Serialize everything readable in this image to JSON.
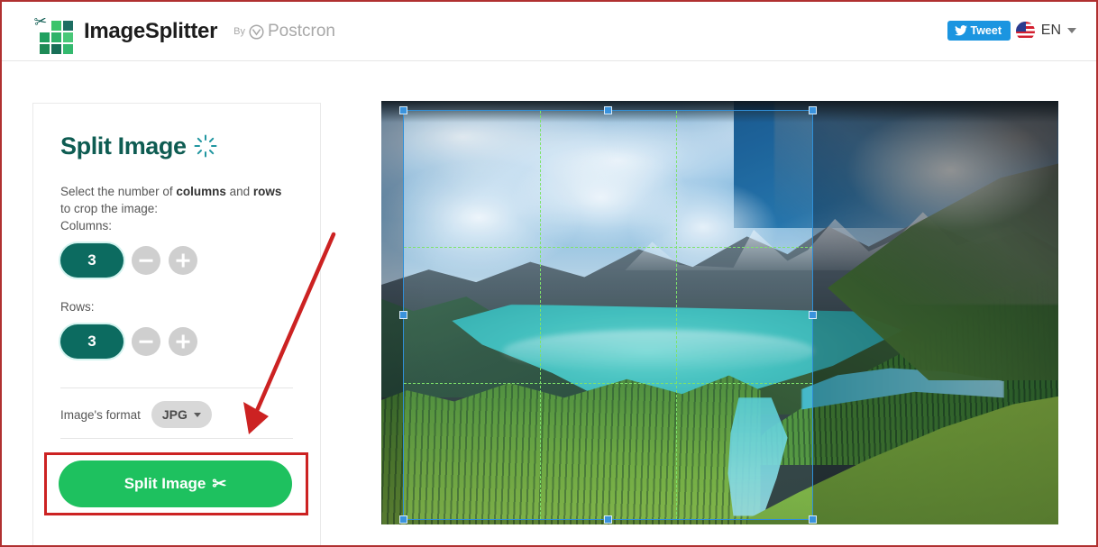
{
  "header": {
    "brand_name": "ImageSplitter",
    "by_word": "By",
    "partner_name": "Postcron",
    "tweet_label": "Tweet",
    "lang_label": "EN",
    "logo_icon": "scissors-grid-icon",
    "twitter_icon": "twitter-bird-icon",
    "flag_icon": "us-flag-icon",
    "caret_icon": "chevron-down-icon"
  },
  "panel": {
    "title": "Split Image",
    "title_icon": "sparkle-burst-icon",
    "description_prefix": "Select the number of ",
    "description_bold_1": "columns",
    "description_middle": " and ",
    "description_bold_2": "rows",
    "description_suffix": " to crop the image:",
    "columns_label": "Columns:",
    "columns_value": "3",
    "rows_label": "Rows:",
    "rows_value": "3",
    "minus_icon": "minus-icon",
    "plus_icon": "plus-icon",
    "format_label": "Image's format",
    "format_value": "JPG",
    "format_caret_icon": "chevron-down-icon",
    "split_button_label": "Split Image",
    "split_button_icon": "scissors-icon",
    "split_button_glyph": "✂"
  },
  "annotations": {
    "arrow": "red-arrow-pointing-to-split-button",
    "highlight": "red-rectangle-around-split-button",
    "arrow_color": "#cc2222",
    "highlight_color": "#cc2222"
  },
  "image_panel": {
    "name": "mountain-lake-landscape",
    "crop_columns": 3,
    "crop_rows": 3,
    "selection_border_color": "#2f8fd8",
    "grid_line_color": "#7ee36a"
  },
  "colors": {
    "teal": "#0c6b60",
    "green_button": "#1ec15f",
    "twitter_blue": "#1b95e0",
    "title_teal": "#0e5c52",
    "page_border": "#b03030"
  }
}
